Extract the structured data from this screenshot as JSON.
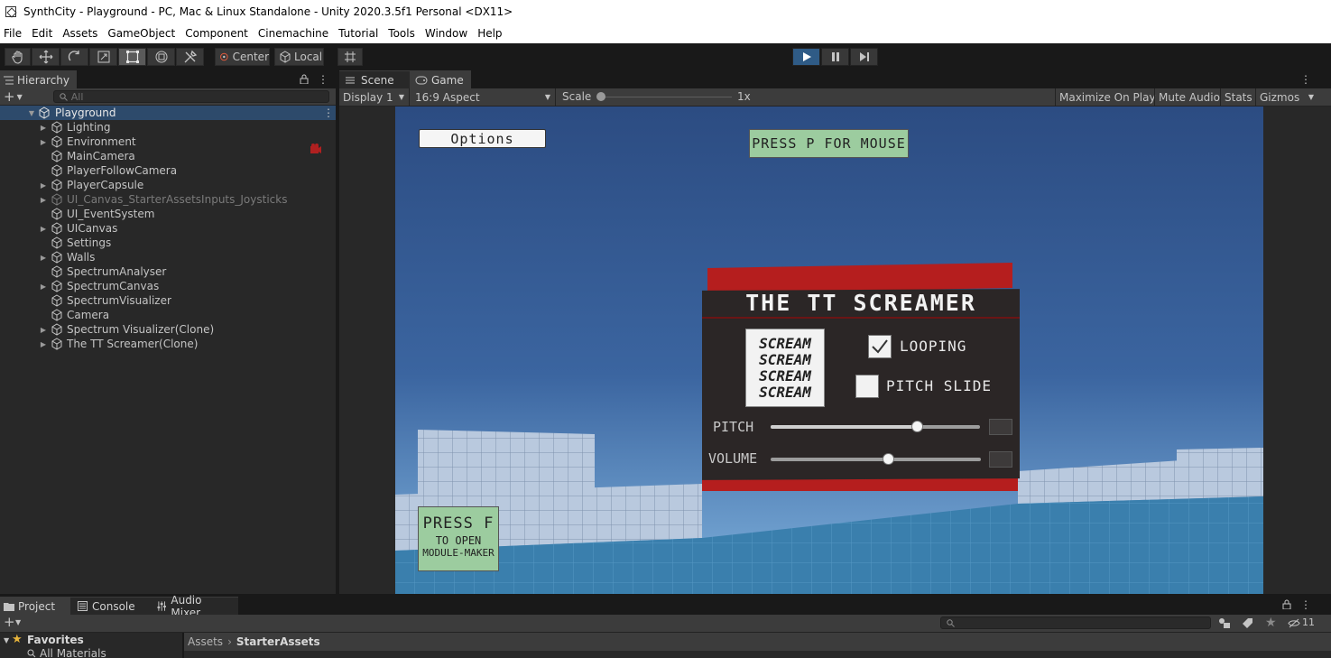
{
  "window": {
    "title": "SynthCity - Playground - PC, Mac & Linux Standalone - Unity 2020.3.5f1 Personal <DX11>"
  },
  "menu": [
    "File",
    "Edit",
    "Assets",
    "GameObject",
    "Component",
    "Cinemachine",
    "Tutorial",
    "Tools",
    "Window",
    "Help"
  ],
  "toolbar": {
    "pivot_label": "Center",
    "space_label": "Local"
  },
  "hierarchy": {
    "tab_label": "Hierarchy",
    "search_placeholder": "All",
    "root": "Playground",
    "items": [
      {
        "label": "Lighting",
        "expandable": true,
        "dim": false
      },
      {
        "label": "Environment",
        "expandable": true,
        "dim": false
      },
      {
        "label": "MainCamera",
        "expandable": false,
        "dim": false
      },
      {
        "label": "PlayerFollowCamera",
        "expandable": false,
        "dim": false
      },
      {
        "label": "PlayerCapsule",
        "expandable": true,
        "dim": false
      },
      {
        "label": "UI_Canvas_StarterAssetsInputs_Joysticks",
        "expandable": true,
        "dim": true
      },
      {
        "label": "UI_EventSystem",
        "expandable": false,
        "dim": false
      },
      {
        "label": "UICanvas",
        "expandable": true,
        "dim": false
      },
      {
        "label": "Settings",
        "expandable": false,
        "dim": false
      },
      {
        "label": "Walls",
        "expandable": true,
        "dim": false
      },
      {
        "label": "SpectrumAnalyser",
        "expandable": false,
        "dim": false
      },
      {
        "label": "SpectrumCanvas",
        "expandable": true,
        "dim": false
      },
      {
        "label": "SpectrumVisualizer",
        "expandable": false,
        "dim": false
      },
      {
        "label": "Camera",
        "expandable": false,
        "dim": false
      },
      {
        "label": "Spectrum Visualizer(Clone)",
        "expandable": true,
        "dim": false
      },
      {
        "label": "The TT Screamer(Clone)",
        "expandable": true,
        "dim": false
      }
    ]
  },
  "game_panel": {
    "tabs": [
      {
        "label": "Scene",
        "icon": "scene-icon"
      },
      {
        "label": "Game",
        "icon": "gamepad-icon"
      }
    ],
    "display": "Display 1",
    "aspect": "16:9 Aspect",
    "scale_label": "Scale",
    "scale_value": "1x",
    "scale_fraction": 0.0,
    "maximize": "Maximize On Play",
    "mute": "Mute Audio",
    "stats": "Stats",
    "gizmos": "Gizmos"
  },
  "game": {
    "options_button": "Options",
    "mouse_hint": "PRESS P FOR MOUSE",
    "module_hint_title": "PRESS F",
    "module_hint_line1": "TO OPEN",
    "module_hint_line2": "MODULE-MAKER",
    "panel_title": "THE TT SCREAMER",
    "scream_words": [
      "SCREAM",
      "SCREAM",
      "SCREAM",
      "SCREAM"
    ],
    "looping_label": "LOOPING",
    "looping_checked": true,
    "pitch_slide_label": "PITCH SLIDE",
    "pitch_slide_checked": false,
    "pitch_label": "PITCH",
    "pitch_value": 0.7,
    "volume_label": "VOLUME",
    "volume_value": 0.56,
    "colors": {
      "sky_top": "#2c4c82",
      "sky_bottom": "#7fb2dd",
      "floor": "#3b7fae",
      "panel_red": "#b51e1e",
      "panel_dark": "#2b2626",
      "hint_green": "#9ccc9f"
    }
  },
  "bottom": {
    "tabs": [
      {
        "label": "Project",
        "icon": "folder-icon"
      },
      {
        "label": "Console",
        "icon": "console-icon"
      },
      {
        "label": "Audio Mixer",
        "icon": "mixer-icon"
      }
    ],
    "favorites_label": "Favorites",
    "all_materials": "All Materials",
    "breadcrumb": [
      "Assets",
      "StarterAssets"
    ],
    "hidden_count": "11"
  }
}
